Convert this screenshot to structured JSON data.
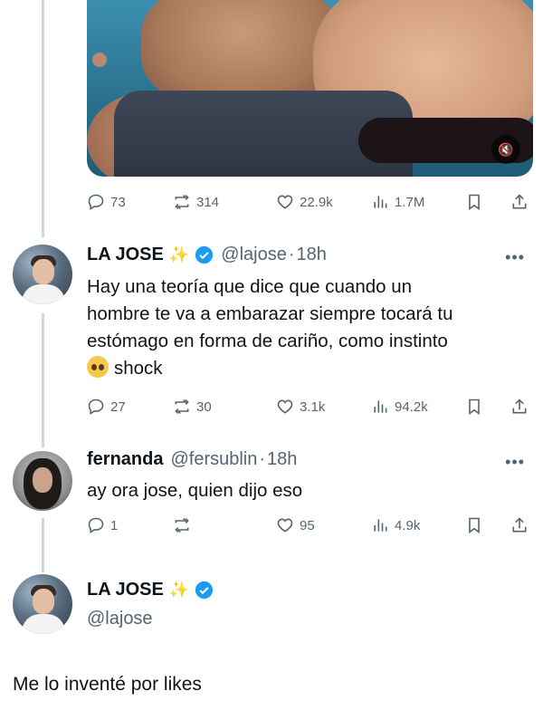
{
  "post1": {
    "actions": {
      "replies": "73",
      "reposts": "314",
      "likes": "22.9k",
      "views": "1.7M"
    }
  },
  "post2": {
    "name": "LA JOSE",
    "sparkle": "✨",
    "handle": "@lajose",
    "time": "18h",
    "text_line1": "Hay una teoría que dice que cuando un",
    "text_line2": "hombre te va a embarazar siempre tocará tu",
    "text_line3": "estómago en forma de cariño, como instinto",
    "text_line4": "shock",
    "actions": {
      "replies": "27",
      "reposts": "30",
      "likes": "3.1k",
      "views": "94.2k"
    }
  },
  "post3": {
    "name": "fernanda",
    "handle": "@fersublin",
    "time": "18h",
    "text": "ay ora jose, quien dijo eso",
    "actions": {
      "replies": "1",
      "reposts": "",
      "likes": "95",
      "views": "4.9k"
    }
  },
  "post4": {
    "name": "LA JOSE",
    "sparkle": "✨",
    "handle": "@lajose"
  },
  "footer_text": "Me lo inventé por likes",
  "colors": {
    "text": "#0f1419",
    "muted": "#536471",
    "verified": "#1d9bf0",
    "thread": "#cfd9de"
  },
  "icons": [
    "reply-icon",
    "repost-icon",
    "like-icon",
    "views-icon",
    "bookmark-icon",
    "share-icon",
    "verified-icon",
    "more-icon",
    "mute-icon"
  ]
}
